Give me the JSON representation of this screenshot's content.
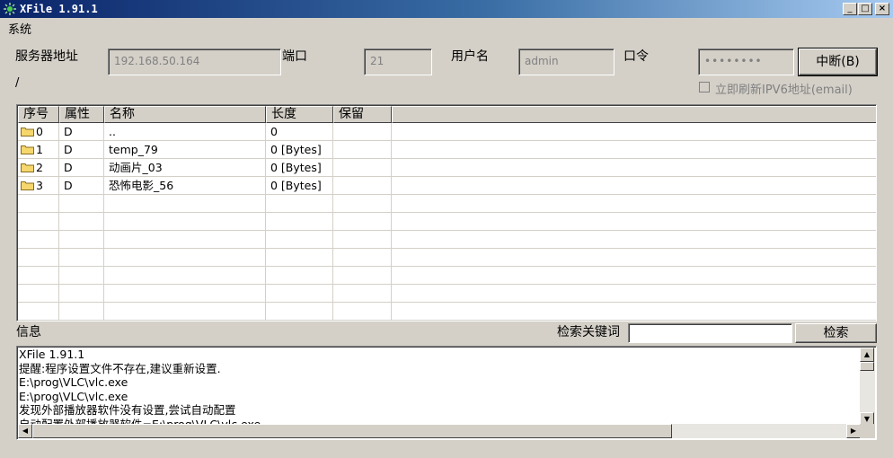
{
  "window": {
    "title": "XFile 1.91.1",
    "min_glyph": "_",
    "max_glyph": "□",
    "close_glyph": "×"
  },
  "menu": {
    "items": [
      {
        "label": "系统"
      }
    ]
  },
  "connection": {
    "server_label": "服务器地址",
    "server_value": "192.168.50.164",
    "port_label": "端口",
    "port_value": "21",
    "user_label": "用户名",
    "user_value": "admin",
    "password_label": "口令",
    "password_value": "••••••••",
    "disconnect_button": "中断(B)",
    "refresh_ipv6_label": "立即刷新IPV6地址(email)",
    "refresh_ipv6_checked": false
  },
  "current_path": "/",
  "file_list": {
    "columns": [
      "序号",
      "属性",
      "名称",
      "长度",
      "保留"
    ],
    "rows": [
      {
        "index": "0",
        "attr": "D",
        "name": "..",
        "size": "0",
        "reserved": ""
      },
      {
        "index": "1",
        "attr": "D",
        "name": "temp_79",
        "size": "0 [Bytes]",
        "reserved": ""
      },
      {
        "index": "2",
        "attr": "D",
        "name": "动画片_03",
        "size": "0 [Bytes]",
        "reserved": ""
      },
      {
        "index": "3",
        "attr": "D",
        "name": "恐怖电影_56",
        "size": "0 [Bytes]",
        "reserved": ""
      }
    ],
    "folder_icon": "folder-icon",
    "folder_color": "#f5d76e"
  },
  "info": {
    "label": "信息",
    "search_label": "检索关键词",
    "search_value": "",
    "search_button": "检索",
    "log_lines": [
      "XFile 1.91.1",
      "提醒:程序设置文件不存在,建议重新设置.",
      "E:\\prog\\VLC\\vlc.exe",
      "E:\\prog\\VLC\\vlc.exe",
      "发现外部播放器软件没有设置,尝试自动配置",
      "自动配置外部播放器软件=E:\\prog\\VLC\\vlc.exe"
    ]
  }
}
